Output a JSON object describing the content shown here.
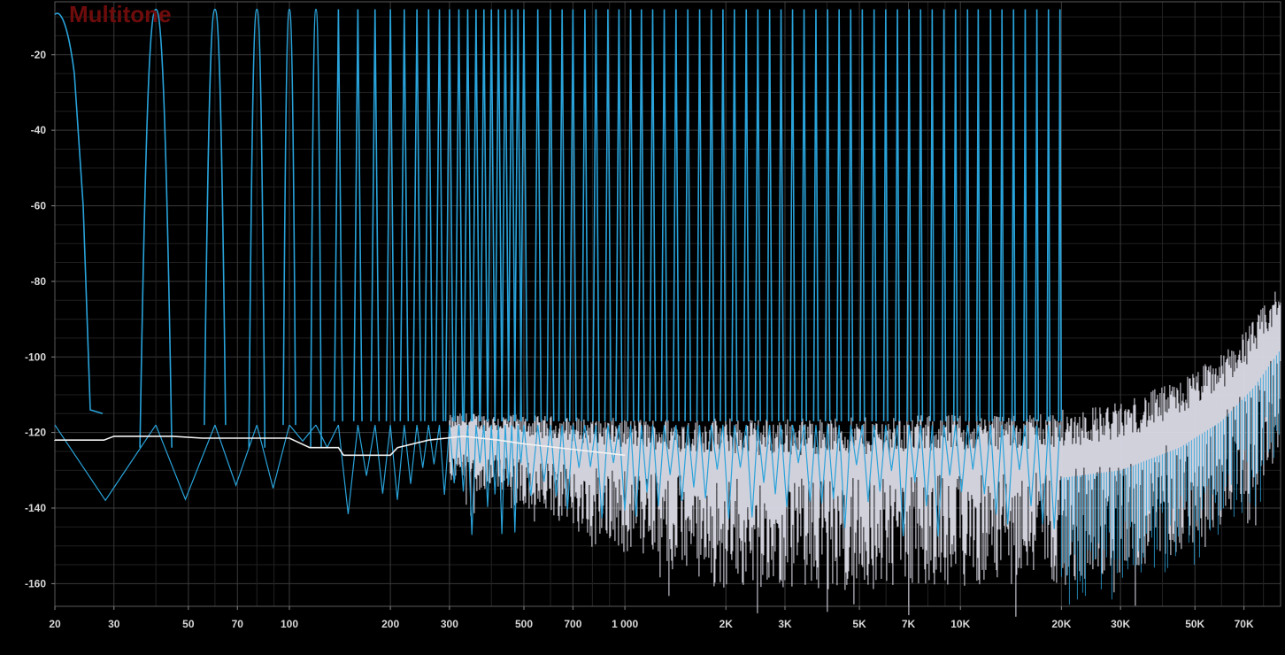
{
  "chart_data": {
    "type": "line",
    "title": "Multitone",
    "xlabel": "",
    "ylabel": "",
    "x_scale": "log",
    "xlim": [
      20,
      90000
    ],
    "ylim": [
      -166,
      -6
    ],
    "grid": true,
    "x_ticks": [
      {
        "value": 20,
        "label": "20"
      },
      {
        "value": 30,
        "label": "30"
      },
      {
        "value": 50,
        "label": "50"
      },
      {
        "value": 70,
        "label": "70"
      },
      {
        "value": 100,
        "label": "100"
      },
      {
        "value": 200,
        "label": "200"
      },
      {
        "value": 300,
        "label": "300"
      },
      {
        "value": 500,
        "label": "500"
      },
      {
        "value": 700,
        "label": "700"
      },
      {
        "value": 1000,
        "label": "1 000"
      },
      {
        "value": 2000,
        "label": "2K"
      },
      {
        "value": 3000,
        "label": "3K"
      },
      {
        "value": 5000,
        "label": "5K"
      },
      {
        "value": 7000,
        "label": "7K"
      },
      {
        "value": 10000,
        "label": "10K"
      },
      {
        "value": 20000,
        "label": "20K"
      },
      {
        "value": 30000,
        "label": "30K"
      },
      {
        "value": 50000,
        "label": "50K"
      },
      {
        "value": 70000,
        "label": "70K"
      }
    ],
    "y_ticks": [
      {
        "value": -20,
        "label": "-20"
      },
      {
        "value": -40,
        "label": "-40"
      },
      {
        "value": -60,
        "label": "-60"
      },
      {
        "value": -80,
        "label": "-80"
      },
      {
        "value": -100,
        "label": "-100"
      },
      {
        "value": -120,
        "label": "-120"
      },
      {
        "value": -140,
        "label": "-140"
      },
      {
        "value": -160,
        "label": "-160"
      }
    ],
    "series": [
      {
        "color": "#29a3da",
        "tone_level": -8,
        "tone_floor": -117,
        "tone_frequencies": [
          20,
          40,
          60,
          80,
          100,
          120,
          140,
          160,
          180,
          200,
          220,
          240,
          260,
          280,
          300,
          320,
          340,
          360,
          380,
          400,
          420,
          440,
          460,
          480,
          500,
          550,
          600,
          650,
          700,
          760,
          820,
          890,
          960,
          1040,
          1120,
          1210,
          1310,
          1420,
          1540,
          1670,
          1810,
          1960,
          2120,
          2300,
          2490,
          2700,
          2920,
          3160,
          3420,
          3710,
          4020,
          4350,
          4710,
          5100,
          5530,
          5990,
          6490,
          7030,
          7610,
          8240,
          8930,
          9670,
          10500,
          11300,
          12300,
          13300,
          14400,
          15600,
          16900,
          18300,
          19800
        ]
      },
      {
        "color": "#dcdce8",
        "noise_floor": [
          {
            "x": 20,
            "y": -122
          },
          {
            "x": 28,
            "y": -122
          },
          {
            "x": 30,
            "y": -121
          },
          {
            "x": 45,
            "y": -121
          },
          {
            "x": 55,
            "y": -121.5
          },
          {
            "x": 100,
            "y": -121.5
          },
          {
            "x": 115,
            "y": -124
          },
          {
            "x": 140,
            "y": -124
          },
          {
            "x": 145,
            "y": -126
          },
          {
            "x": 200,
            "y": -126
          },
          {
            "x": 210,
            "y": -124
          },
          {
            "x": 260,
            "y": -122
          },
          {
            "x": 330,
            "y": -121
          },
          {
            "x": 420,
            "y": -122
          },
          {
            "x": 500,
            "y": -123
          },
          {
            "x": 1000,
            "y": -126
          },
          {
            "x": 2000,
            "y": -128
          },
          {
            "x": 5000,
            "y": -128
          },
          {
            "x": 10000,
            "y": -127
          },
          {
            "x": 20000,
            "y": -126
          },
          {
            "x": 30000,
            "y": -124
          },
          {
            "x": 45000,
            "y": -118
          },
          {
            "x": 60000,
            "y": -111
          },
          {
            "x": 75000,
            "y": -102
          },
          {
            "x": 90000,
            "y": -92
          }
        ]
      }
    ]
  }
}
